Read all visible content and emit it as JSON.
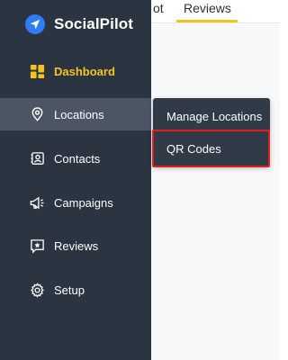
{
  "app": {
    "name": "SocialPilot"
  },
  "top_tabs": [
    {
      "label": "ot"
    },
    {
      "label": "Reviews",
      "active": true
    }
  ],
  "sidebar": {
    "items": [
      {
        "label": "Dashboard",
        "icon": "dashboard-grid-icon",
        "active": true
      },
      {
        "label": "Locations",
        "icon": "location-pin-icon",
        "expanded": true
      },
      {
        "label": "Contacts",
        "icon": "contacts-icon"
      },
      {
        "label": "Campaigns",
        "icon": "megaphone-icon"
      },
      {
        "label": "Reviews",
        "icon": "star-box-icon"
      },
      {
        "label": "Setup",
        "icon": "gear-icon"
      }
    ]
  },
  "submenu": {
    "items": [
      {
        "label": "Manage Locations"
      },
      {
        "label": "QR Codes",
        "highlighted": true
      }
    ]
  },
  "colors": {
    "sidebar_bg": "#2b3441",
    "hover_bg": "#4b5563",
    "submenu_bg": "#313a47",
    "accent_yellow": "#f7c320",
    "tab_underline": "#f2c318",
    "highlight_red": "#e0201f",
    "brand_blue": "#2f7cf6"
  }
}
